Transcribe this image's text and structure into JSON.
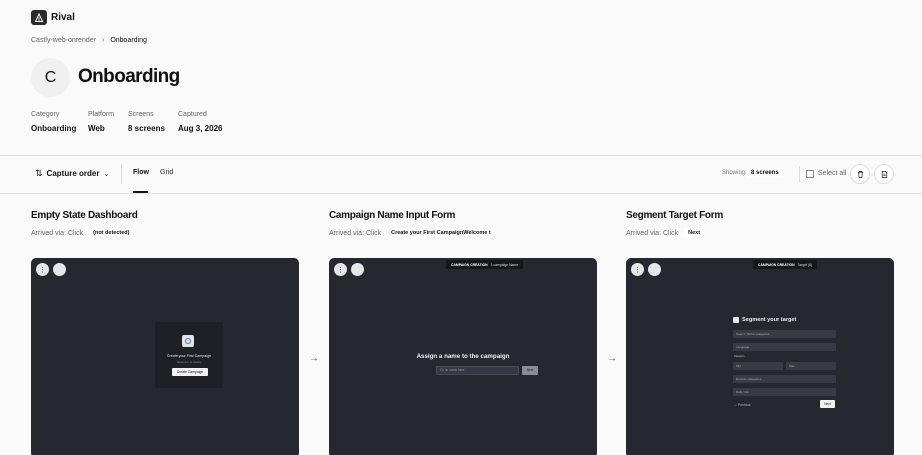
{
  "app": {
    "brand": "Rival"
  },
  "breadcrumb": {
    "parent": "Castly-web-onrender",
    "current": "Onboarding"
  },
  "header": {
    "avatar_letter": "C",
    "title": "Onboarding",
    "meta": [
      {
        "label": "Category",
        "value": "Onboarding"
      },
      {
        "label": "Platform",
        "value": "Web"
      },
      {
        "label": "Screens",
        "value": "8 screens"
      },
      {
        "label": "Captured",
        "value": "Aug 3, 2026"
      }
    ]
  },
  "toolbar": {
    "sort_label": "Capture order",
    "tabs": [
      {
        "label": "Flow",
        "active": true
      },
      {
        "label": "Grid",
        "active": false
      }
    ],
    "showing_label": "Showing",
    "showing_count": "8 screens",
    "select_all": "Select all"
  },
  "screens": [
    {
      "title": "Empty State Dashboard",
      "arrived": "Arrived via: Click",
      "trigger": "(not detected)",
      "content": {
        "heading": "Create your First Campaign",
        "sub": "Welcome to Castly",
        "button": "Create Campaign"
      }
    },
    {
      "title": "Campaign Name Input Form",
      "arrived": "Arrived via: Click",
      "trigger": "Create your First CampaignWelcome t",
      "content": {
        "chip_bold": "CAMPAIGN CREATION",
        "chip_text": "1 campaign Name",
        "heading": "Assign a name to the campaign",
        "placeholder": "Cx no name here",
        "button": "Next"
      }
    },
    {
      "title": "Segment Target Form",
      "arrived": "Arrived via: Click",
      "trigger": "Next",
      "content": {
        "chip_bold": "CAMPAIGN CREATION",
        "chip_text": "Target (8)",
        "heading": "Segment your target",
        "search": "Search TikTok categories",
        "language": "Language",
        "viewers_label": "Viewers",
        "min": "Min",
        "max": "Max",
        "exclude": "Exclude categories",
        "daily": "Daily Out",
        "previous": "← Previous",
        "next": "Next"
      }
    }
  ],
  "colors": {
    "card_bg": "#262830",
    "page_bg": "#fafafa"
  }
}
